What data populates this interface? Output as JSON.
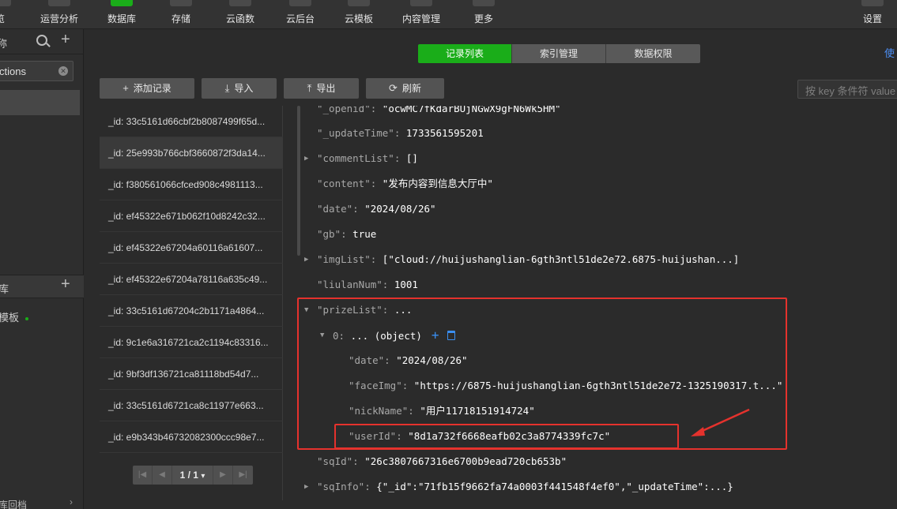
{
  "toolbar": {
    "items": [
      {
        "label": "览",
        "glyph": ""
      },
      {
        "label": "运营分析",
        "glyph": "|||"
      },
      {
        "label": "数据库",
        "glyph": "▤"
      },
      {
        "label": "存储",
        "glyph": ""
      },
      {
        "label": "云函数",
        "glyph": "↗"
      },
      {
        "label": "云后台",
        "glyph": "⬡"
      },
      {
        "label": "云模板",
        "glyph": "▥"
      },
      {
        "label": "内容管理",
        "glyph": ""
      },
      {
        "label": "更多",
        "glyph": "≋▾"
      },
      {
        "label": "设置",
        "glyph": "⚙"
      }
    ]
  },
  "sidebar": {
    "title": "称",
    "search_value": "ctions",
    "section_title": "库",
    "env_label": "模板",
    "bottom_text": "库回档",
    "chevron": "›"
  },
  "tabs": [
    {
      "label": "记录列表",
      "active": true
    },
    {
      "label": "索引管理",
      "active": false
    },
    {
      "label": "数据权限",
      "active": false
    }
  ],
  "use_link": "使",
  "actions": [
    {
      "icon": "+",
      "label": "添加记录"
    },
    {
      "icon": "⤓",
      "label": "导入"
    },
    {
      "icon": "⤒",
      "label": "导出"
    },
    {
      "icon": "⟳",
      "label": "刷新"
    }
  ],
  "filter_placeholder": "按 key 条件符 value",
  "records": [
    "_id: 33c5161d66cbf2b8087499f65d...",
    "_id: 25e993b766cbf3660872f3da14...",
    "_id: f380561066cfced908c4981113...",
    "_id: ef45322e671b062f10d8242c32...",
    "_id: ef45322e67204a60116a61607...",
    "_id: ef45322e67204a78116a635c49...",
    "_id: 33c5161d67204c2b1171a4864...",
    "_id: 9c1e6a316721ca2c1194c83316...",
    "_id: 9bf3df136721ca81118bd54d7...",
    "_id: 33c5161d6721ca8c11977e663...",
    "_id: e9b343b46732082300ccc98e7..."
  ],
  "pager": {
    "label": "1 / 1",
    "first": "|◀",
    "prev": "◀",
    "next": "▶",
    "last": "▶|",
    "caret": "▾"
  },
  "detail": {
    "openid": {
      "key": "\"_openid\":",
      "value": "\"ocwMC7fKdarBUjNGwX9gFN6Wk5HM\""
    },
    "updateTime": {
      "key": "\"_updateTime\":",
      "value": "1733561595201"
    },
    "commentList": {
      "key": "\"commentList\":",
      "value": "[]"
    },
    "content": {
      "key": "\"content\":",
      "value": "\"发布内容到信息大厅中\""
    },
    "date": {
      "key": "\"date\":",
      "value": "\"2024/08/26\""
    },
    "gb": {
      "key": "\"gb\":",
      "value": "true"
    },
    "imgList": {
      "key": "\"imgList\":",
      "value": "[\"cloud://huijushanglian-6gth3ntl51de2e72.6875-huijushan...]"
    },
    "liulanNum": {
      "key": "\"liulanNum\":",
      "value": "1001"
    },
    "prizeList": {
      "key": "\"prizeList\":",
      "value": "..."
    },
    "item0": {
      "key": "0:",
      "value": "... (object)"
    },
    "p_date": {
      "key": "\"date\":",
      "value": "\"2024/08/26\""
    },
    "p_faceImg": {
      "key": "\"faceImg\":",
      "value": "\"https://6875-huijushanglian-6gth3ntl51de2e72-1325190317.t...\""
    },
    "p_nickName": {
      "key": "\"nickName\":",
      "value": "\"用户11718151914724\""
    },
    "p_userId": {
      "key": "\"userId\":",
      "value": "\"8d1a732f6668eafb02c3a8774339fc7c\""
    },
    "sqId": {
      "key": "\"sqId\":",
      "value": "\"26c3807667316e6700b9ead720cb653b\""
    },
    "sqInfo": {
      "key": "\"sqInfo\":",
      "value": "{\"_id\":\"71fb15f9662fa74a0003f441548f4ef0\",\"_updateTime\":...}"
    }
  },
  "colors": {
    "accent": "#1aad19",
    "annotation": "#e5322d",
    "link": "#4c8ff5"
  }
}
